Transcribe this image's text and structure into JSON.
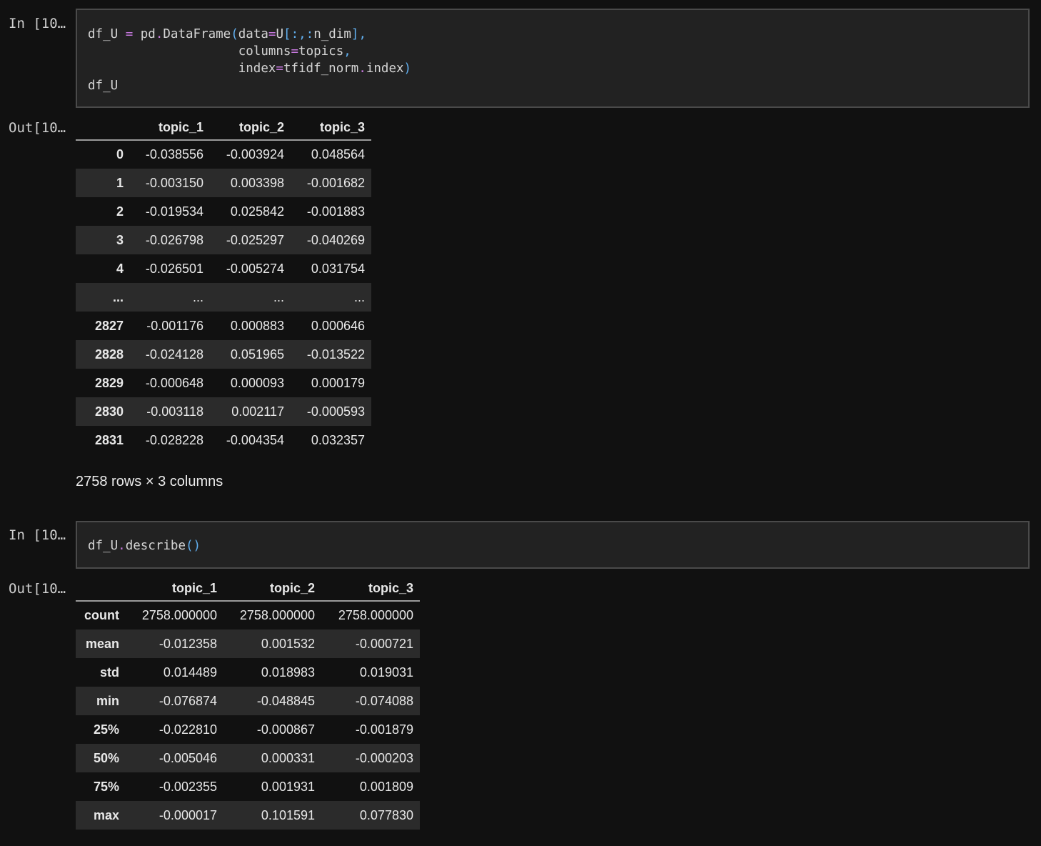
{
  "cells": [
    {
      "in_prompt": "In [10…",
      "out_prompt": "Out[10…",
      "code_lines": [
        "df_U = pd.DataFrame(data=U[:,:n_dim],",
        "                    columns=topics,",
        "                    index=tfidf_norm.index)",
        "df_U"
      ],
      "table": {
        "columns": [
          "",
          "topic_1",
          "topic_2",
          "topic_3"
        ],
        "rows": [
          [
            "0",
            "-0.038556",
            "-0.003924",
            "0.048564"
          ],
          [
            "1",
            "-0.003150",
            "0.003398",
            "-0.001682"
          ],
          [
            "2",
            "-0.019534",
            "0.025842",
            "-0.001883"
          ],
          [
            "3",
            "-0.026798",
            "-0.025297",
            "-0.040269"
          ],
          [
            "4",
            "-0.026501",
            "-0.005274",
            "0.031754"
          ],
          [
            "...",
            "...",
            "...",
            "..."
          ],
          [
            "2827",
            "-0.001176",
            "0.000883",
            "0.000646"
          ],
          [
            "2828",
            "-0.024128",
            "0.051965",
            "-0.013522"
          ],
          [
            "2829",
            "-0.000648",
            "0.000093",
            "0.000179"
          ],
          [
            "2830",
            "-0.003118",
            "0.002117",
            "-0.000593"
          ],
          [
            "2831",
            "-0.028228",
            "-0.004354",
            "0.032357"
          ]
        ]
      },
      "summary": "2758 rows × 3 columns"
    },
    {
      "in_prompt": "In [10…",
      "out_prompt": "Out[10…",
      "code_lines": [
        "df_U.describe()"
      ],
      "table": {
        "columns": [
          "",
          "topic_1",
          "topic_2",
          "topic_3"
        ],
        "rows": [
          [
            "count",
            "2758.000000",
            "2758.000000",
            "2758.000000"
          ],
          [
            "mean",
            "-0.012358",
            "0.001532",
            "-0.000721"
          ],
          [
            "std",
            "0.014489",
            "0.018983",
            "0.019031"
          ],
          [
            "min",
            "-0.076874",
            "-0.048845",
            "-0.074088"
          ],
          [
            "25%",
            "-0.022810",
            "-0.000867",
            "-0.001879"
          ],
          [
            "50%",
            "-0.005046",
            "0.000331",
            "-0.000203"
          ],
          [
            "75%",
            "-0.002355",
            "0.001931",
            "0.001809"
          ],
          [
            "max",
            "-0.000017",
            "0.101591",
            "0.077830"
          ]
        ]
      }
    }
  ]
}
